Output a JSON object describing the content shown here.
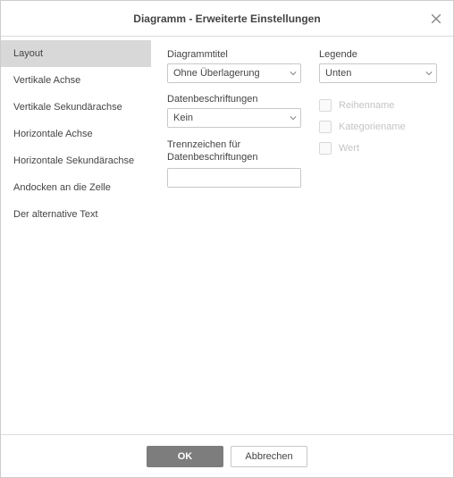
{
  "dialog": {
    "title": "Diagramm - Erweiterte Einstellungen"
  },
  "sidebar": {
    "items": [
      {
        "label": "Layout",
        "active": true
      },
      {
        "label": "Vertikale Achse",
        "active": false
      },
      {
        "label": "Vertikale Sekundärachse",
        "active": false
      },
      {
        "label": "Horizontale Achse",
        "active": false
      },
      {
        "label": "Horizontale Sekundärachse",
        "active": false
      },
      {
        "label": "Andocken an die Zelle",
        "active": false
      },
      {
        "label": "Der alternative Text",
        "active": false
      }
    ]
  },
  "layout": {
    "chartTitle": {
      "label": "Diagrammtitel",
      "value": "Ohne Überlagerung"
    },
    "legend": {
      "label": "Legende",
      "value": "Unten"
    },
    "dataLabels": {
      "label": "Datenbeschriftungen",
      "value": "Kein"
    },
    "separator": {
      "label": "Trennzeichen für Datenbeschriftungen",
      "value": ""
    },
    "checks": {
      "series": "Reihenname",
      "category": "Kategoriename",
      "value": "Wert"
    }
  },
  "footer": {
    "ok": "OK",
    "cancel": "Abbrechen"
  }
}
